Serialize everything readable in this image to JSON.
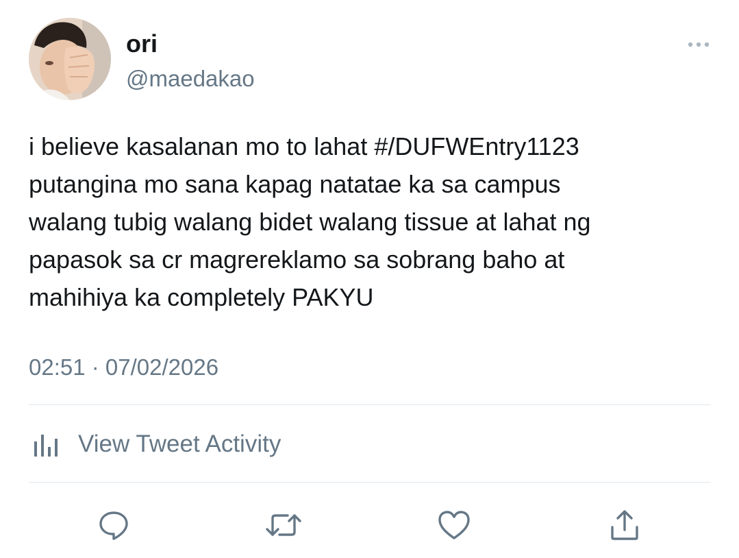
{
  "tweet": {
    "display_name": "ori",
    "handle": "@maedakao",
    "text_lines": [
      "i believe kasalanan mo to lahat #/DUFWEntry1123",
      "putangina mo sana kapag natatae ka sa campus",
      "walang tubig walang bidet walang tissue at lahat ng",
      "papasok sa cr magrereklamo sa sobrang baho at",
      "mahihiya ka completely PAKYU"
    ],
    "timestamp": "02:51 · 07/02/2026"
  },
  "activity": {
    "label": "View Tweet Activity",
    "icon": "bar-chart-icon"
  },
  "actions": {
    "reply_icon": "reply-icon",
    "retweet_icon": "retweet-icon",
    "like_icon": "heart-icon",
    "share_icon": "share-icon"
  },
  "colors": {
    "text_primary": "#14171a",
    "text_secondary": "#657786",
    "divider": "#e1e8ed",
    "icon": "#657786"
  }
}
